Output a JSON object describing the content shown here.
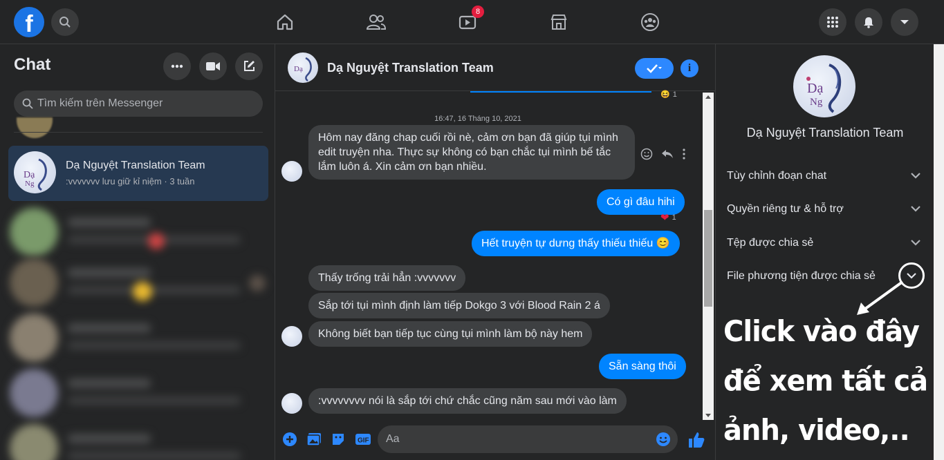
{
  "topbar": {
    "video_badge": "8"
  },
  "sidebar": {
    "title": "Chat",
    "search_placeholder": "Tìm kiếm trên Messenger",
    "active_conversation": {
      "name": "Dạ Nguyệt Translation Team",
      "preview": ":vvvvvvv lưu giữ kỉ niệm · 3 tuần"
    }
  },
  "conversation": {
    "name": "Dạ Nguyệt Translation Team",
    "timestamp": "16:47, 16 Tháng 10, 2021",
    "messages": [
      {
        "from": "them",
        "text": "Hôm nay đăng chap cuối rồi nè, cảm ơn bạn đã giúp tụi mình edit truyện nha. Thực sự không có bạn chắc tụi mình bế tắc lắm luôn á. Xin cảm ơn bạn nhiều."
      },
      {
        "from": "me",
        "text": "Có gì đâu hihi",
        "reaction_count": "1"
      },
      {
        "from": "me",
        "text": "Hết truyện tự dưng thấy thiếu thiếu 😊"
      },
      {
        "from": "them",
        "text": "Thấy trống trải hẳn :vvvvvvv"
      },
      {
        "from": "them",
        "text": "Sắp tới tụi mình định làm tiếp Dokgo 3 với Blood Rain 2 á"
      },
      {
        "from": "them",
        "text": "Không biết bạn tiếp tục cùng tụi mình làm bộ này hem"
      },
      {
        "from": "me",
        "text": "Sẵn sàng thôi"
      },
      {
        "from": "them",
        "text": ":vvvvvvvv nói là sắp tới chứ chắc cũng năm sau mới vào làm"
      }
    ],
    "top_reaction_count": "1",
    "composer_placeholder": "Aa"
  },
  "info_panel": {
    "name": "Dạ Nguyệt Translation Team",
    "menu": [
      "Tùy chỉnh đoạn chat",
      "Quyền riêng tư & hỗ trợ",
      "Tệp được chia sẻ",
      "File phương tiện được chia sẻ"
    ]
  },
  "annotation": {
    "line1": "Click vào đây",
    "line2": "để xem tất cả",
    "line3": "ảnh, video,.."
  },
  "colors": {
    "accent": "#0084ff",
    "background": "#242526",
    "bubble_in": "#3e4042"
  }
}
